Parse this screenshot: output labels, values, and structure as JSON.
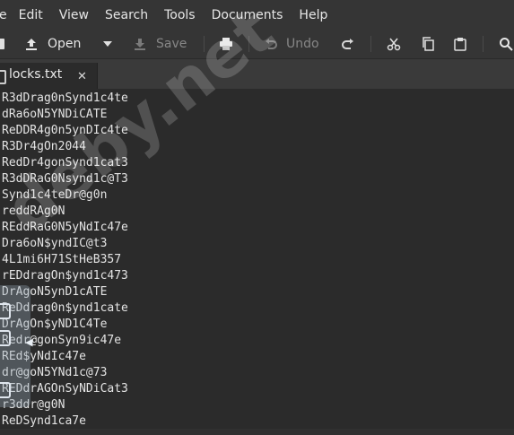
{
  "menubar": {
    "items": [
      "e",
      "Edit",
      "View",
      "Search",
      "Tools",
      "Documents",
      "Help"
    ]
  },
  "toolbar": {
    "open_label": "Open",
    "save_label": "Save",
    "undo_label": "Undo"
  },
  "tab": {
    "title": "locks.txt",
    "close_glyph": "✕"
  },
  "editor": {
    "lines": [
      "R3dDrag0nSynd1c4te",
      "dRa6oN5YNDiCATE",
      "ReDDR4g0n5ynDIc4te",
      "R3Dr4gOn2044",
      "RedDr4gonSynd1cat3",
      "R3dDRaG0Nsynd1c@T3",
      "Synd1c4teDr@g0n",
      "reddRAg0N",
      "REddRaG0N5yNdIc47e",
      "Dra6oN$yndIC@t3",
      "4L1mi6H71StHeB357",
      "rEDdragOn$ynd1c473",
      "DrAgoN5ynD1cATE",
      "ReDdrag0n$ynd1cate",
      "DrAgOn$yND1C4Te",
      "Redr@gonSyn9ic47e",
      "REd$yNdIc47e",
      "dr@goN5YNd1c@73",
      "REDdrAGOnSyNDiCat3",
      "r3ddr@g0N",
      "ReDSynd1ca7e"
    ]
  },
  "watermark": "deby.net"
}
